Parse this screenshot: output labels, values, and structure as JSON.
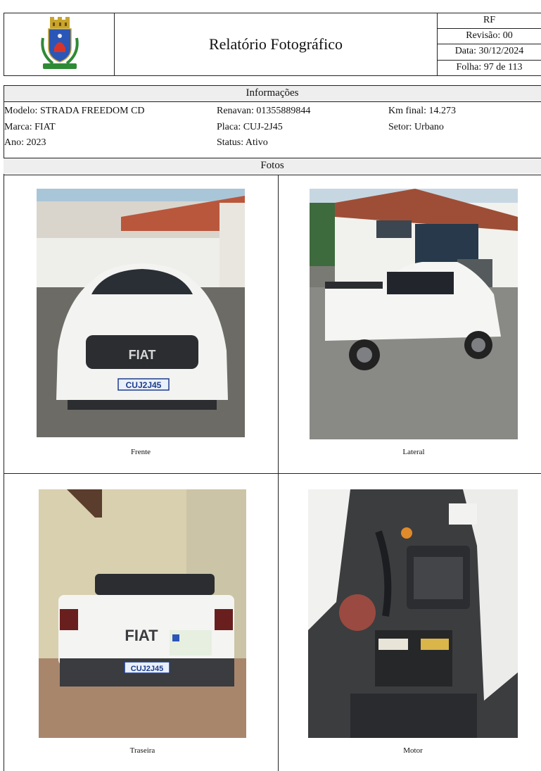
{
  "header": {
    "title": "Relatório Fotográfico",
    "code": "RF",
    "revision": "Revisão: 00",
    "date": "Data: 30/12/2024",
    "page": "Folha: 97 de 113"
  },
  "info": {
    "heading": "Informações",
    "modelo": "Modelo: STRADA FREEDOM CD",
    "marca": "Marca: FIAT",
    "ano": "Ano: 2023",
    "renavan": "Renavan: 01355889844",
    "placa": "Placa: CUJ-2J45",
    "status": "Status: Ativo",
    "km": "Km final: 14.273",
    "setor": "Setor: Urbano"
  },
  "photos": {
    "heading": "Fotos",
    "items": [
      {
        "caption": "Frente",
        "plate": "CUJ2J45",
        "badge": "FIAT"
      },
      {
        "caption": "Lateral"
      },
      {
        "caption": "Traseira",
        "plate": "CUJ2J45",
        "badge": "FIAT"
      },
      {
        "caption": "Motor"
      }
    ]
  }
}
